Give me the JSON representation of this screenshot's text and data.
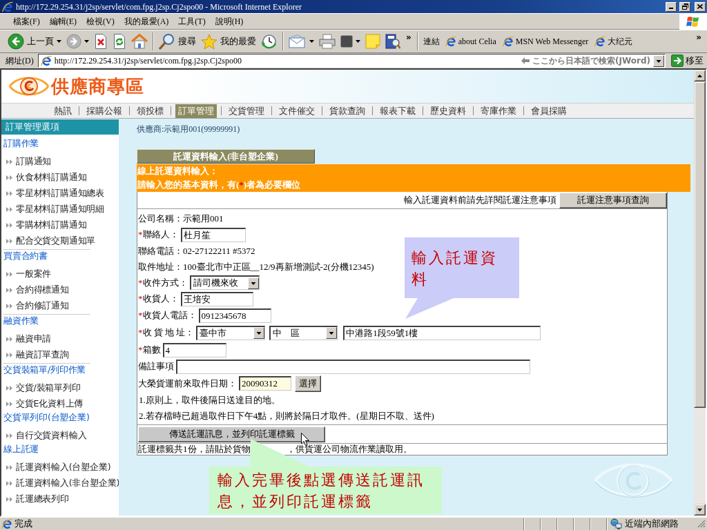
{
  "window": {
    "title": "http://172.29.254.31/j2sp/servlet/com.fpg.j2sp.Cj2spo00 - Microsoft Internet Explorer"
  },
  "menu_bar": [
    "檔案(F)",
    "編輯(E)",
    "檢視(V)",
    "我的最愛(A)",
    "工具(T)",
    "說明(H)"
  ],
  "toolbar": {
    "back": "上一頁",
    "search": "搜尋",
    "favorites": "我的最愛",
    "more": "»"
  },
  "links_bar": {
    "label": "連結",
    "links": [
      "about Celia",
      "MSN Web Messenger",
      "大纪元"
    ],
    "more": "»"
  },
  "address_bar": {
    "label": "網址(D)",
    "value": "http://172.29.254.31/j2sp/servlet/com.fpg.j2sp.Cj2spo00",
    "search_hint": "ここから日本語で検索(JWord)",
    "go": "移至"
  },
  "page": {
    "site_title": "供應商專區",
    "nav": [
      {
        "label": "熱訊",
        "selected": false
      },
      {
        "label": "採購公報",
        "selected": false
      },
      {
        "label": "領投標",
        "selected": false
      },
      {
        "label": "訂單管理",
        "selected": true
      },
      {
        "label": "交貨管理",
        "selected": false
      },
      {
        "label": "文件催交",
        "selected": false
      },
      {
        "label": "貨款查詢",
        "selected": false
      },
      {
        "label": "報表下載",
        "selected": false
      },
      {
        "label": "歷史資料",
        "selected": false
      },
      {
        "label": "寄庫作業",
        "selected": false
      },
      {
        "label": "會員採購",
        "selected": false
      }
    ],
    "sidebar": {
      "title": "訂單管理選項",
      "sections": [
        {
          "heading": "訂購作業",
          "items": [
            "訂購通知",
            "伙食材料訂購通知",
            "零星材料訂購通知總表",
            "零星材料訂購通知明細",
            "零購材料訂購通知",
            "配合交貨交期通知單"
          ],
          "divider": true
        },
        {
          "heading": "買賣合約書",
          "items": [
            "一般案件",
            "合約得標通知",
            "合約修訂通知"
          ],
          "divider": true
        },
        {
          "heading": "融資作業",
          "items": [
            "融資申請",
            "融資訂單查詢"
          ],
          "divider": true
        },
        {
          "heading": "交貨裝箱單/列印作業",
          "items": [
            "交貨/裝箱單列印",
            "交貨E化資料上傳"
          ],
          "divider": false
        },
        {
          "heading": "交貨單列印(台塑企業)",
          "items": [
            "自行交貨資料輸入"
          ],
          "divider": false
        },
        {
          "heading": "線上託運",
          "items": [
            "託運資料輸入(台塑企業)",
            "託運資料輸入(非台塑企業)",
            "託運總表列印"
          ],
          "divider": false
        }
      ]
    },
    "supplier": "供應商:示範用001(99999991)",
    "form": {
      "title": "託運資料輸入(非台塑企業)",
      "banner_title": "線上託運資料輸入：",
      "banner_hint": {
        "before": "請輸入您的基本資料，有(",
        "mark": "*",
        "after": ")者為必要欄位"
      },
      "notice": "輸入託運資料前請先詳閱託運注意事項",
      "notice_button": "託運注意事項查詢",
      "fields": [
        {
          "kind": "static",
          "label": "公司名稱：",
          "value": "示範用001"
        },
        {
          "kind": "input",
          "mark": "*",
          "label": "聯絡人：",
          "value": "杜月笙"
        },
        {
          "kind": "static",
          "label": "聯絡電話：",
          "value": "02-27122211 #5372"
        },
        {
          "kind": "static",
          "label": "取件地址：",
          "value": "100臺北市中正區__12/9再新增測試-2(分機12345)"
        },
        {
          "kind": "select",
          "mark": "*",
          "label": "收件方式：",
          "value": "請司機來收"
        },
        {
          "kind": "input",
          "mark": "*",
          "label": "收貨人：",
          "value": "王培安"
        },
        {
          "kind": "input",
          "mark": "*",
          "label": "收貨人電話：",
          "value": "0912345678"
        },
        {
          "kind": "address",
          "mark": "*",
          "label": "收 貨 地 址：",
          "city": "臺中市",
          "district": "中　區",
          "street": "中港路1段59號1樓"
        },
        {
          "kind": "input",
          "mark": "*",
          "label": "箱數",
          "value": "4"
        },
        {
          "kind": "input",
          "label": "備註事項"
        },
        {
          "kind": "date",
          "label": "大榮貨運前來取件日期：",
          "value": "20090312",
          "button": "選擇"
        }
      ],
      "notes": [
        "1.原則上，取件後隔日送達目的地。",
        "2.若存檔時已超過取件日下午4點，則將於隔日才取件。(星期日不取、送件)"
      ],
      "submit": "傳送託運訊息，並列印託運標籤",
      "footer_note": [
        "託運標籤共1份，請貼於貨物",
        "，供貨運公司物流作業讀取用。"
      ]
    },
    "callouts": [
      {
        "text": "輸入託運資料",
        "color": "#ccccf8"
      },
      {
        "text": "輸入完畢後點選傳送託運訊息，並列印託運標籤",
        "color": "#ccf8cc"
      }
    ]
  },
  "status_bar": {
    "text": "完成",
    "zone": "近端內部網路"
  }
}
